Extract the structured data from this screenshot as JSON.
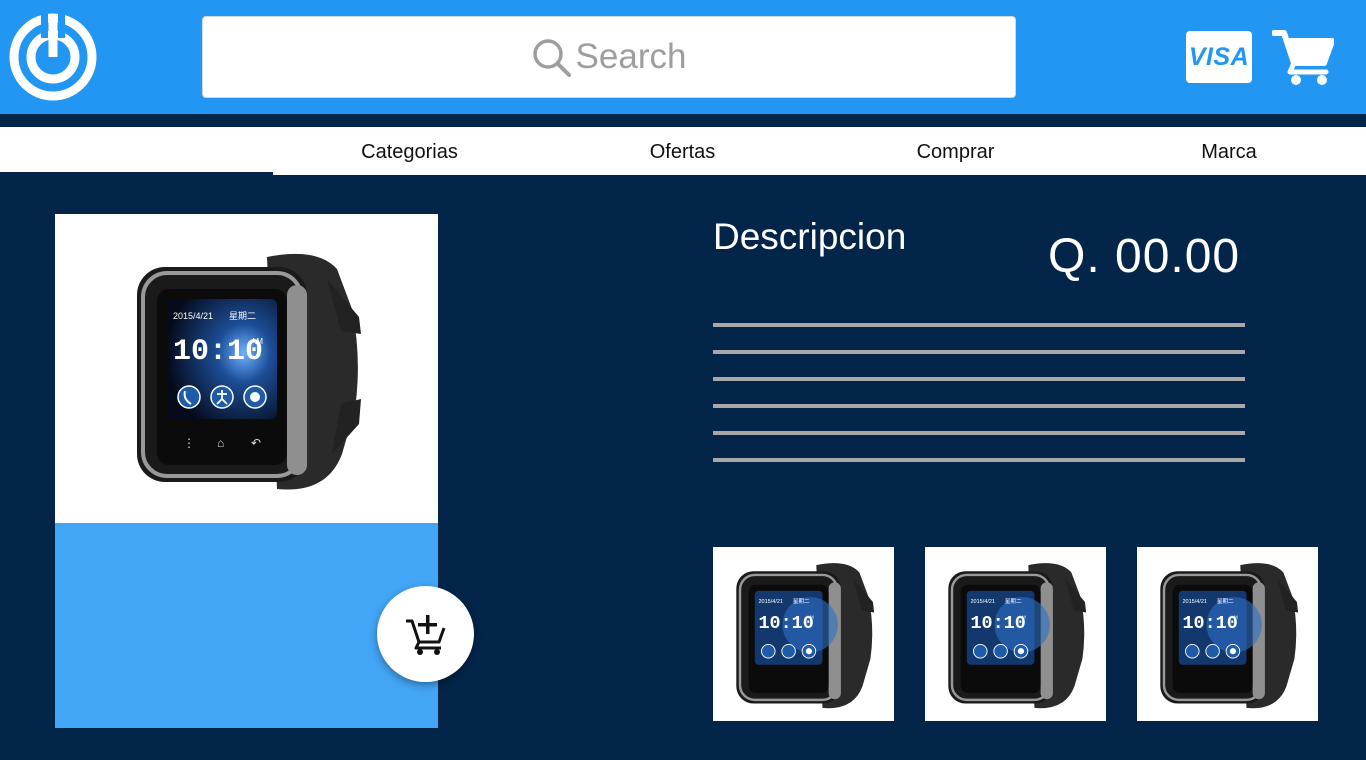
{
  "header": {
    "logo_icon": "power-target-logo-icon",
    "search": {
      "placeholder": "Search",
      "icon": "search-icon"
    },
    "payment_badge": "VISA",
    "cart_icon": "shopping-cart-icon",
    "colors": {
      "header_bg": "#2196f3",
      "page_bg": "#03254a",
      "accent_panel": "#42a5f5"
    }
  },
  "nav": {
    "items": [
      {
        "label": "Categorias"
      },
      {
        "label": "Ofertas"
      },
      {
        "label": "Comprar"
      },
      {
        "label": "Marca"
      }
    ]
  },
  "product": {
    "image": "smartwatch-image",
    "add_to_cart_icon": "add-to-cart-icon",
    "description_title": "Descripcion",
    "price": "Q. 00.00",
    "description_lines": 6,
    "thumbnails": [
      "smartwatch-thumbnail",
      "smartwatch-thumbnail",
      "smartwatch-thumbnail"
    ],
    "watch_screen": {
      "date": "2015/4/21",
      "day": "星期二",
      "time": "10:10",
      "ampm": "AM"
    }
  }
}
